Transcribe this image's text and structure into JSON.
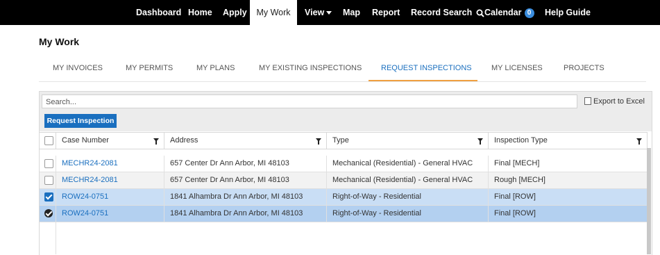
{
  "nav": {
    "items": [
      {
        "label": "Dashboard"
      },
      {
        "label": "Home"
      },
      {
        "label": "Apply"
      },
      {
        "label": "My Work"
      },
      {
        "label": "View"
      },
      {
        "label": "Map"
      },
      {
        "label": "Report"
      },
      {
        "label": "Record Search"
      },
      {
        "label": "Calendar",
        "badge": "0"
      },
      {
        "label": "Help Guide"
      }
    ]
  },
  "page": {
    "title": "My Work"
  },
  "tabs": [
    {
      "label": "MY INVOICES"
    },
    {
      "label": "MY PERMITS"
    },
    {
      "label": "MY PLANS"
    },
    {
      "label": "MY EXISTING INSPECTIONS"
    },
    {
      "label": "REQUEST INSPECTIONS",
      "active": true
    },
    {
      "label": "MY LICENSES"
    },
    {
      "label": "PROJECTS"
    }
  ],
  "grid": {
    "search_placeholder": "Search...",
    "export_label": "Export to Excel",
    "request_button": "Request Inspection",
    "columns": [
      "Case Number",
      "Address",
      "Type",
      "Inspection Type"
    ],
    "rows": [
      {
        "case": "MECHR24-2081",
        "address": "657 Center Dr Ann Arbor, MI 48103",
        "type": "Mechanical (Residential) - General HVAC",
        "inspection": "Final [MECH]",
        "checked": false
      },
      {
        "case": "MECHR24-2081",
        "address": "657 Center Dr Ann Arbor, MI 48103",
        "type": "Mechanical (Residential) - General HVAC",
        "inspection": "Rough [MECH]",
        "checked": false
      },
      {
        "case": "ROW24-0751",
        "address": "1841 Alhambra Dr Ann Arbor, MI 48103",
        "type": "Right-of-Way - Residential",
        "inspection": "Final [ROW]",
        "checked": true
      },
      {
        "case": "ROW24-0751",
        "address": "1841 Alhambra Dr Ann Arbor, MI 48103",
        "type": "Right-of-Way - Residential",
        "inspection": "Final [ROW]",
        "checked": true
      }
    ]
  },
  "colors": {
    "topbar": "#000000",
    "accent": "#1a6fbf",
    "tab_underline": "#f0a040",
    "row_alt": "#f2f2f2",
    "row_selected": "#c9def5",
    "row_selected_focus": "#b3d0f0"
  }
}
